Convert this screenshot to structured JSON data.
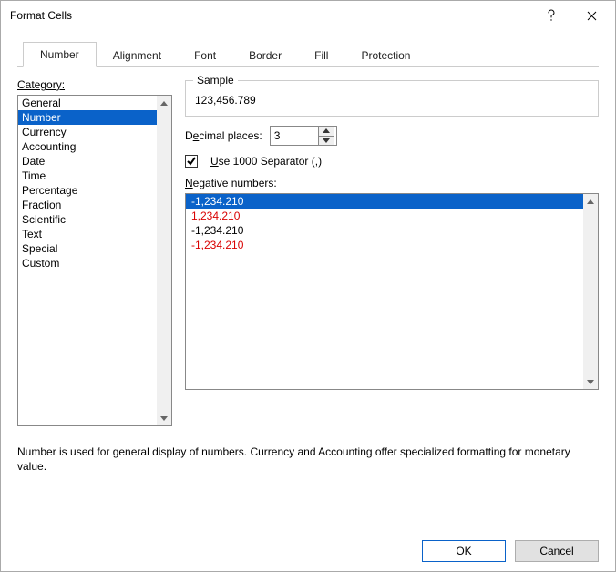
{
  "window": {
    "title": "Format Cells"
  },
  "tabs": {
    "number": "Number",
    "alignment": "Alignment",
    "font": "Font",
    "border": "Border",
    "fill": "Fill",
    "protection": "Protection"
  },
  "category_label": "Category:",
  "category": {
    "items": {
      "0": "General",
      "1": "Number",
      "2": "Currency",
      "3": "Accounting",
      "4": "Date",
      "5": "Time",
      "6": "Percentage",
      "7": "Fraction",
      "8": "Scientific",
      "9": "Text",
      "10": "Special",
      "11": "Custom"
    }
  },
  "sample": {
    "legend": "Sample",
    "value": "123,456.789"
  },
  "decimal": {
    "label_pre": "D",
    "label_u": "e",
    "label_post": "cimal places:",
    "value": "3"
  },
  "separator": {
    "label_u": "U",
    "label_post": "se 1000 Separator (,)"
  },
  "negative": {
    "label_u": "N",
    "label_post": "egative numbers:",
    "items": {
      "0": "-1,234.210",
      "1": "1,234.210",
      "2": "-1,234.210",
      "3": "-1,234.210"
    }
  },
  "description": "Number is used for general display of numbers.  Currency and Accounting offer specialized formatting for monetary value.",
  "buttons": {
    "ok": "OK",
    "cancel": "Cancel"
  }
}
